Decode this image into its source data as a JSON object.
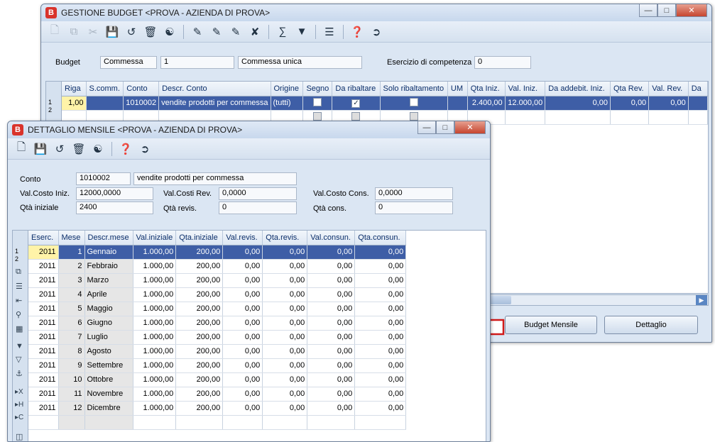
{
  "gb": {
    "title": "GESTIONE BUDGET <PROVA - AZIENDA DI PROVA>",
    "budget_label": "Budget",
    "budget_type": "Commessa",
    "budget_num": "1",
    "budget_desc": "Commessa unica",
    "esercizio_label": "Esercizio di competenza",
    "esercizio_value": "0",
    "columns": [
      "Riga",
      "S.comm.",
      "Conto",
      "Descr. Conto",
      "Origine",
      "Segno",
      "Da ribaltare",
      "Solo ribaltamento",
      "UM",
      "Qta Iniz.",
      "Val. Iniz.",
      "Da addebit. Iniz.",
      "Qta Rev.",
      "Val. Rev.",
      "Da"
    ],
    "row": {
      "riga": "1,00",
      "scomm": "",
      "conto": "1010002",
      "descr": "vendite prodotti per commessa",
      "origine": "(tutti)",
      "um": "",
      "qta_iniz": "2.400,00",
      "val_iniz": "12.000,00",
      "da_addebit": "0,00",
      "qta_rev": "0,00",
      "val_rev": "0,00"
    },
    "row_numbers": [
      "1",
      "2"
    ],
    "btn_budget_mensile": "Budget Mensile",
    "btn_dettaglio": "Dettaglio"
  },
  "dm": {
    "title": "DETTAGLIO MENSILE <PROVA - AZIENDA DI PROVA>",
    "conto_label": "Conto",
    "conto_value": "1010002",
    "conto_desc": "vendite prodotti per commessa",
    "valcosto_iniz_label": "Val.Costo Iniz.",
    "valcosto_iniz_value": "12000,0000",
    "valcosti_rev_label": "Val.Costi Rev.",
    "valcosti_rev_value": "0,0000",
    "valcosto_cons_label": "Val.Costo Cons.",
    "valcosto_cons_value": "0,0000",
    "qta_iniz_label": "Qtà iniziale",
    "qta_iniz_value": "2400",
    "qta_revis_label": "Qtà revis.",
    "qta_revis_value": "0",
    "qta_cons_label": "Qtà cons.",
    "qta_cons_value": "0",
    "columns": [
      "Eserc.",
      "Mese",
      "Descr.mese",
      "Val.iniziale",
      "Qta.iniziale",
      "Val.revis.",
      "Qta.revis.",
      "Val.consun.",
      "Qta.consun."
    ],
    "row_numbers": [
      "1",
      "2"
    ],
    "rows": [
      {
        "eserc": "2011",
        "mese": "1",
        "descr": "Gennaio",
        "val_iniz": "1.000,00",
        "qta_iniz": "200,00",
        "val_rev": "0,00",
        "qta_rev": "0,00",
        "val_cons": "0,00",
        "qta_cons": "0,00"
      },
      {
        "eserc": "2011",
        "mese": "2",
        "descr": "Febbraio",
        "val_iniz": "1.000,00",
        "qta_iniz": "200,00",
        "val_rev": "0,00",
        "qta_rev": "0,00",
        "val_cons": "0,00",
        "qta_cons": "0,00"
      },
      {
        "eserc": "2011",
        "mese": "3",
        "descr": "Marzo",
        "val_iniz": "1.000,00",
        "qta_iniz": "200,00",
        "val_rev": "0,00",
        "qta_rev": "0,00",
        "val_cons": "0,00",
        "qta_cons": "0,00"
      },
      {
        "eserc": "2011",
        "mese": "4",
        "descr": "Aprile",
        "val_iniz": "1.000,00",
        "qta_iniz": "200,00",
        "val_rev": "0,00",
        "qta_rev": "0,00",
        "val_cons": "0,00",
        "qta_cons": "0,00"
      },
      {
        "eserc": "2011",
        "mese": "5",
        "descr": "Maggio",
        "val_iniz": "1.000,00",
        "qta_iniz": "200,00",
        "val_rev": "0,00",
        "qta_rev": "0,00",
        "val_cons": "0,00",
        "qta_cons": "0,00"
      },
      {
        "eserc": "2011",
        "mese": "6",
        "descr": "Giugno",
        "val_iniz": "1.000,00",
        "qta_iniz": "200,00",
        "val_rev": "0,00",
        "qta_rev": "0,00",
        "val_cons": "0,00",
        "qta_cons": "0,00"
      },
      {
        "eserc": "2011",
        "mese": "7",
        "descr": "Luglio",
        "val_iniz": "1.000,00",
        "qta_iniz": "200,00",
        "val_rev": "0,00",
        "qta_rev": "0,00",
        "val_cons": "0,00",
        "qta_cons": "0,00"
      },
      {
        "eserc": "2011",
        "mese": "8",
        "descr": "Agosto",
        "val_iniz": "1.000,00",
        "qta_iniz": "200,00",
        "val_rev": "0,00",
        "qta_rev": "0,00",
        "val_cons": "0,00",
        "qta_cons": "0,00"
      },
      {
        "eserc": "2011",
        "mese": "9",
        "descr": "Settembre",
        "val_iniz": "1.000,00",
        "qta_iniz": "200,00",
        "val_rev": "0,00",
        "qta_rev": "0,00",
        "val_cons": "0,00",
        "qta_cons": "0,00"
      },
      {
        "eserc": "2011",
        "mese": "10",
        "descr": "Ottobre",
        "val_iniz": "1.000,00",
        "qta_iniz": "200,00",
        "val_rev": "0,00",
        "qta_rev": "0,00",
        "val_cons": "0,00",
        "qta_cons": "0,00"
      },
      {
        "eserc": "2011",
        "mese": "11",
        "descr": "Novembre",
        "val_iniz": "1.000,00",
        "qta_iniz": "200,00",
        "val_rev": "0,00",
        "qta_rev": "0,00",
        "val_cons": "0,00",
        "qta_cons": "0,00"
      },
      {
        "eserc": "2011",
        "mese": "12",
        "descr": "Dicembre",
        "val_iniz": "1.000,00",
        "qta_iniz": "200,00",
        "val_rev": "0,00",
        "qta_rev": "0,00",
        "val_cons": "0,00",
        "qta_cons": "0,00"
      }
    ]
  },
  "colors": {
    "selection": "#3e5ea6",
    "arrow": "#d11a1a",
    "window_bg": "#dbe6f3"
  }
}
